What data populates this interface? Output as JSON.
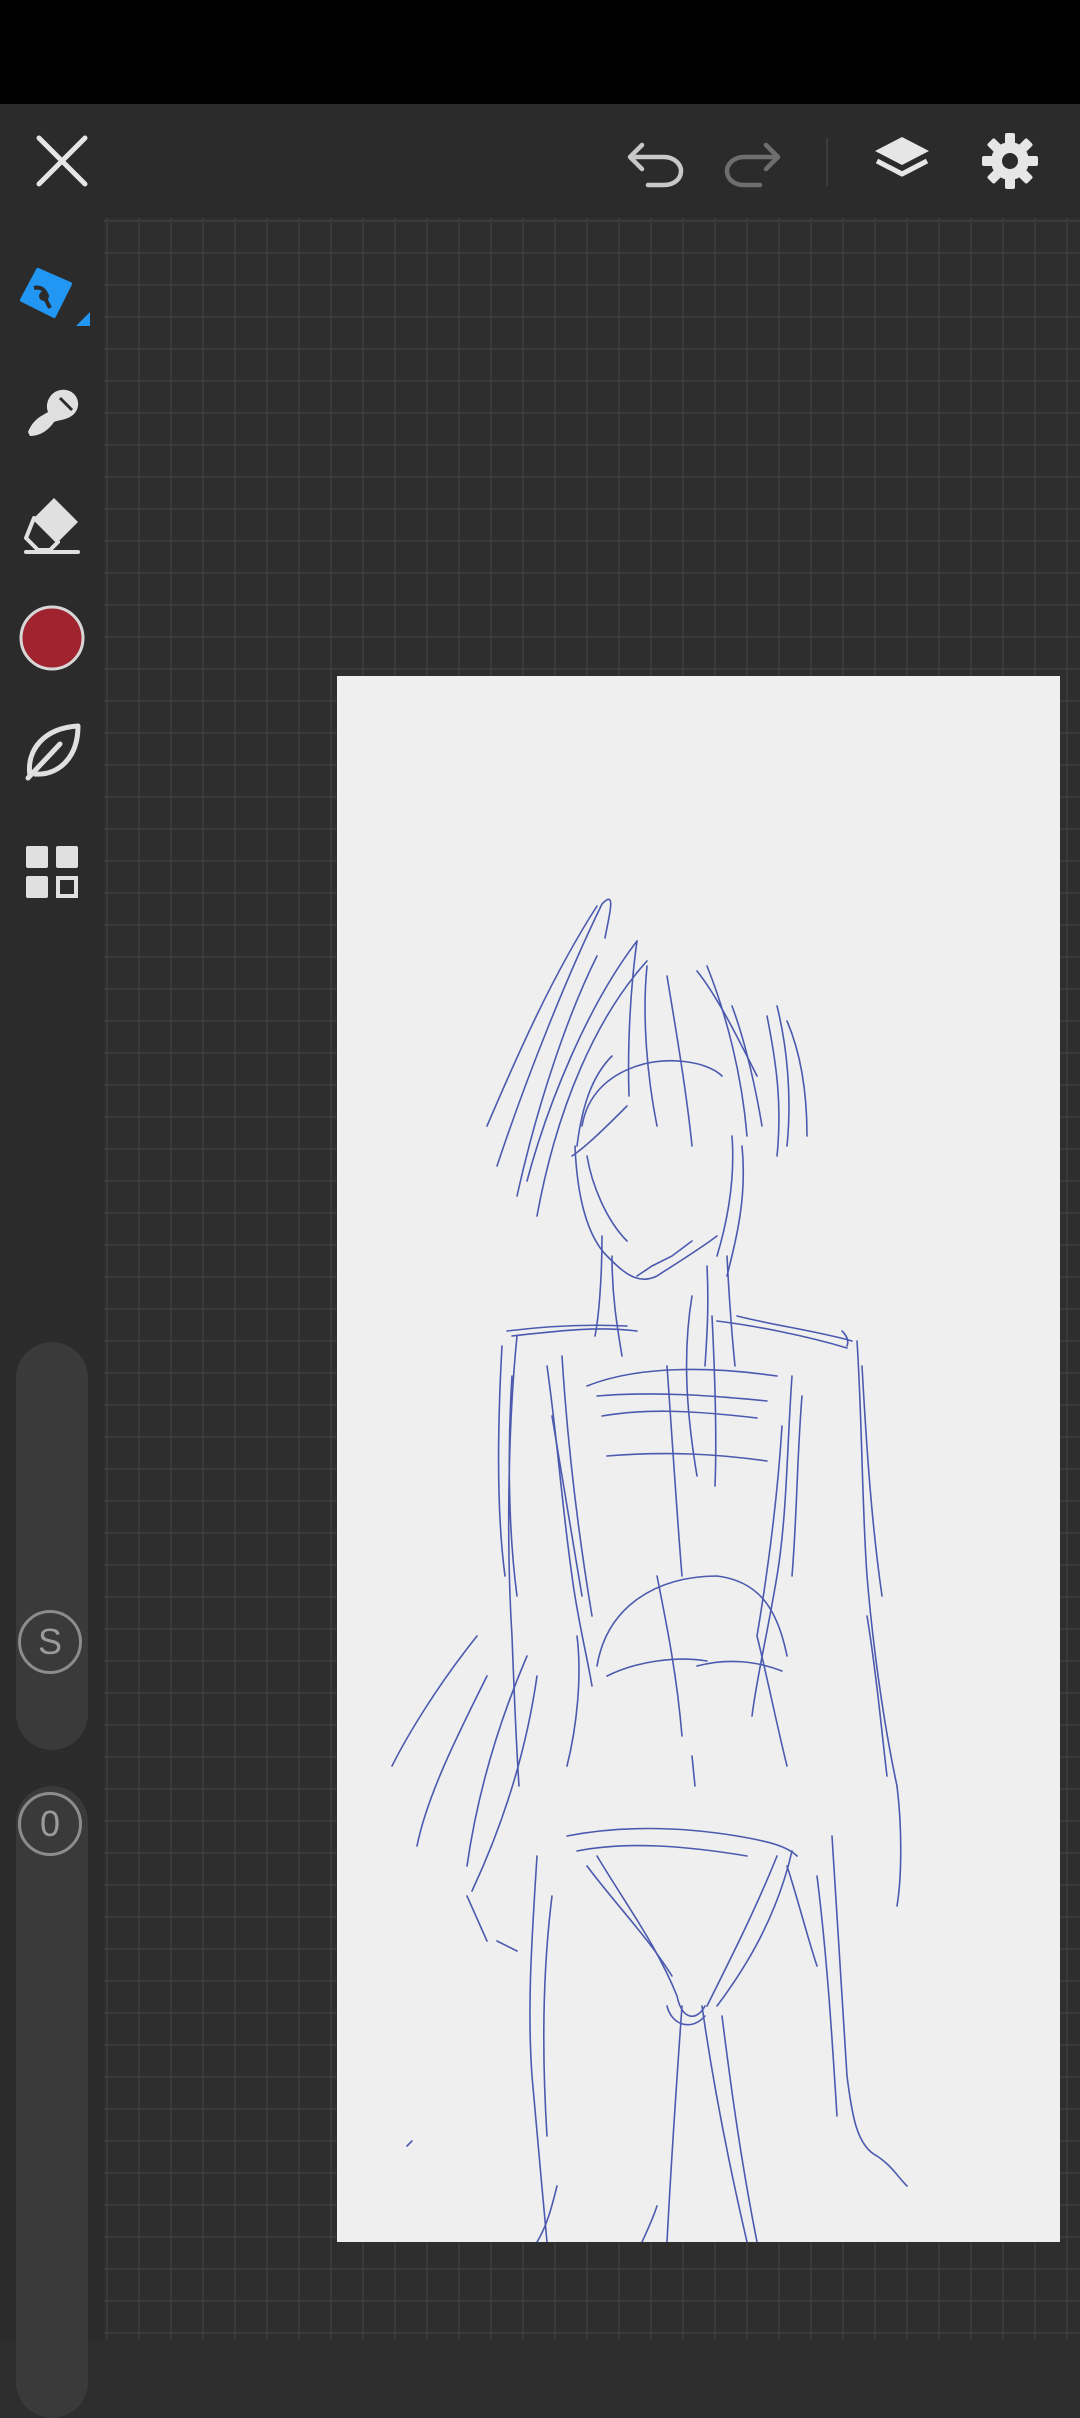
{
  "toolbar": {
    "close_icon": "close-icon",
    "undo_icon": "undo-icon",
    "redo_icon": "redo-icon",
    "layers_icon": "layers-icon",
    "settings_icon": "gear-icon"
  },
  "tools": [
    {
      "name": "pen",
      "icon": "pen-icon",
      "active": true
    },
    {
      "name": "smudge",
      "icon": "smudge-icon"
    },
    {
      "name": "eraser",
      "icon": "eraser-icon"
    },
    {
      "name": "color",
      "icon": "color-swatch"
    },
    {
      "name": "brush",
      "icon": "leaf-icon"
    },
    {
      "name": "more",
      "icon": "grid-icon"
    }
  ],
  "brush_size": {
    "label": "S"
  },
  "opacity": {
    "label": "0"
  },
  "colors": {
    "accent": "#2196f3",
    "current_color": "#a0242f",
    "stroke": "#3a4aa8",
    "paper": "#efefef",
    "background": "#2e2e2e"
  }
}
